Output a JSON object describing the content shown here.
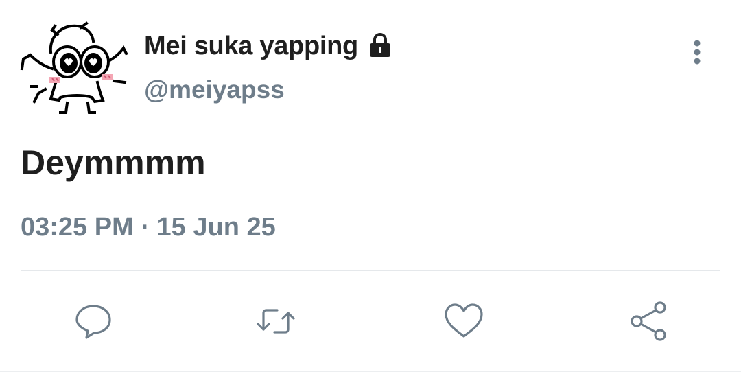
{
  "author": {
    "display_name": "Mei suka yapping",
    "handle": "@meiyapss",
    "avatar_icon": "pixel-art-character-avatar",
    "protected_icon": "lock-icon"
  },
  "tweet": {
    "text": "Deymmmm",
    "time": "03:25 PM",
    "separator": "·",
    "date": "15 Jun 25"
  },
  "actions": [
    {
      "name": "reply",
      "icon": "comment-icon"
    },
    {
      "name": "retweet",
      "icon": "retweet-icon"
    },
    {
      "name": "like",
      "icon": "heart-icon"
    },
    {
      "name": "share",
      "icon": "share-icon"
    }
  ],
  "colors": {
    "text_primary": "#1f1f1f",
    "text_secondary": "#6e7d8a",
    "icon": "#6e7d8a",
    "blush": "#f4a6b4",
    "divider": "#e5e8eb"
  }
}
